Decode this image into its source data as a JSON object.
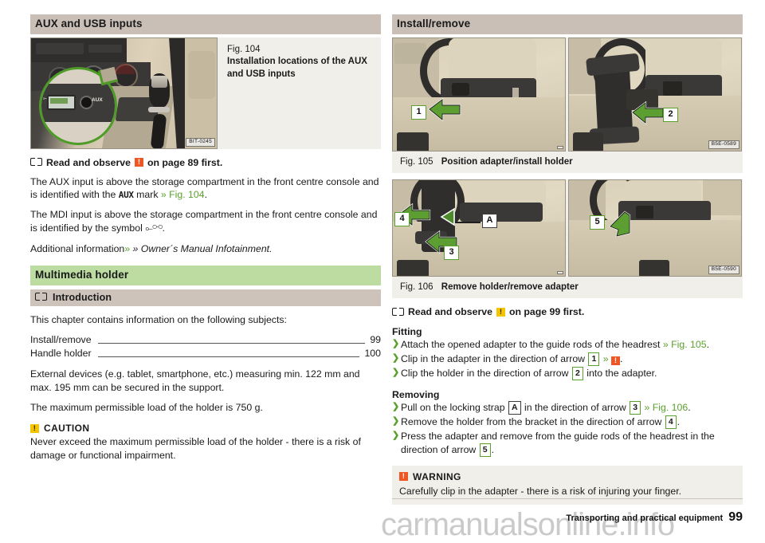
{
  "left": {
    "section_title": "AUX and USB inputs",
    "fig104": {
      "number": "Fig. 104",
      "title": "Installation locations of the AUX and USB inputs",
      "image_code": "BIT-0245",
      "labels": {
        "usb": "USB",
        "aux": "AUX"
      }
    },
    "read_note": {
      "prefix": "Read and observe",
      "icon": "warning-bang-orange",
      "suffix": "on page 89 first."
    },
    "para_aux_1": "The AUX input is above the storage compartment in the front centre console and is identified with the",
    "aux_mark": "AUX",
    "para_aux_2": "mark",
    "aux_xref": "» Fig. 104",
    "para_mdi_1": "The MDI input is above the storage compartment in the front centre console and is identified by the symbol",
    "para_additional": "Additional information",
    "additional_xref": "» Owner´s Manual Infotainment.",
    "multimedia_title": "Multimedia holder",
    "intro_title": "Introduction",
    "intro_lead": "This chapter contains information on the following subjects:",
    "toc": [
      {
        "label": "Install/remove",
        "page": "99"
      },
      {
        "label": "Handle holder",
        "page": "100"
      }
    ],
    "para_devices": "External devices (e.g. tablet, smartphone, etc.) measuring min. 122 mm and max. 195 mm can be secured in the support.",
    "para_load": "The maximum permissible load of the holder is 750 g.",
    "caution": {
      "title": "CAUTION",
      "icon": "caution-bang-yellow",
      "text": "Never exceed the maximum permissible load of the holder - there is a risk of damage or functional impairment."
    }
  },
  "right": {
    "section_title": "Install/remove",
    "fig105": {
      "number": "Fig. 105",
      "title": "Position adapter/install holder",
      "image_code": "B5E-0589",
      "callouts": [
        "1",
        "2"
      ]
    },
    "fig106": {
      "number": "Fig. 106",
      "title": "Remove holder/remove adapter",
      "image_code": "B5E-0590",
      "callouts": [
        "4",
        "A",
        "3",
        "5"
      ]
    },
    "read_note": {
      "prefix": "Read and observe",
      "icon": "caution-bang-yellow",
      "suffix": "on page 99 first."
    },
    "fitting": {
      "title": "Fitting",
      "steps": [
        {
          "pre": "Attach the opened adapter to the guide rods of the headrest",
          "xref": "» Fig. 105",
          "post": "."
        },
        {
          "pre": "Clip in the adapter in the direction of arrow",
          "box": "1",
          "mid": "»",
          "icon": "warning-bang-orange",
          "post": "."
        },
        {
          "pre": "Clip the holder in the direction of arrow",
          "box": "2",
          "post": "into the adapter."
        }
      ]
    },
    "removing": {
      "title": "Removing",
      "steps": [
        {
          "pre": "Pull on the locking strap",
          "boxDark": "A",
          "mid": "in the direction of arrow",
          "box": "3",
          "xref": "» Fig. 106",
          "post": "."
        },
        {
          "pre": "Remove the holder from the bracket in the direction of arrow",
          "box": "4",
          "post": "."
        },
        {
          "pre": "Press the adapter and remove from the guide rods of the headrest in the direction of arrow",
          "box": "5",
          "post": "."
        }
      ]
    },
    "warning": {
      "title": "WARNING",
      "icon": "warning-bang-orange",
      "text": "Carefully clip in the adapter - there is a risk of injuring your finger."
    }
  },
  "footer": {
    "chapter": "Transporting and practical equipment",
    "page_number": "99",
    "watermark": "carmanualsonline.info"
  },
  "colors": {
    "band_grey": "#c9bfb7",
    "band_green": "#bcdca2",
    "figure_bg": "#f1efea",
    "accent_green": "#5aa02c",
    "warn_orange": "#ef5623",
    "caution_yellow": "#f5c400"
  }
}
